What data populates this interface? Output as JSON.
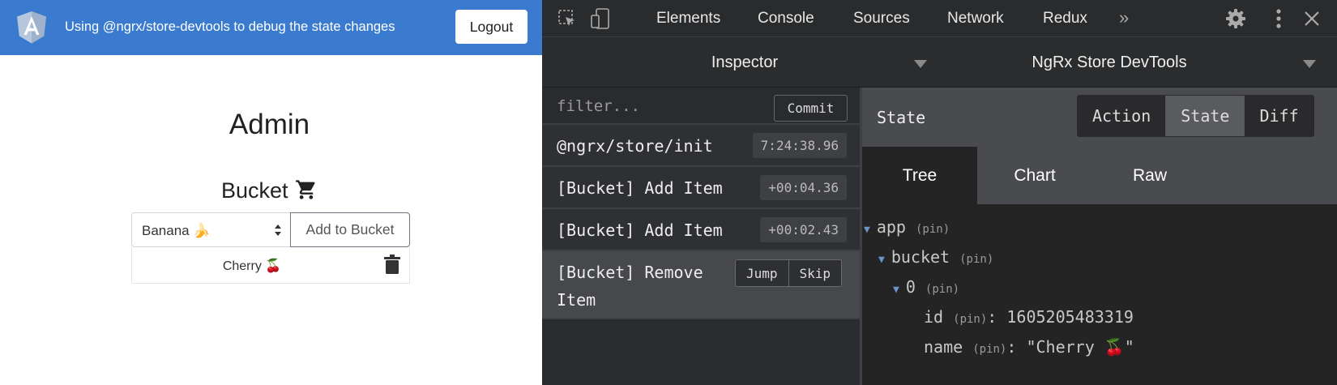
{
  "app": {
    "header_title": "Using @ngrx/store-devtools to debug the state changes",
    "logout_label": "Logout",
    "page_title": "Admin",
    "bucket_heading": "Bucket",
    "select_value": "Banana 🍌",
    "add_button_label": "Add to Bucket",
    "bucket_items": [
      "Cherry 🍒"
    ],
    "brand_color": "#3a7bd0"
  },
  "devtools": {
    "tabs": [
      "Elements",
      "Console",
      "Sources",
      "Network",
      "Redux"
    ],
    "more_tabs_glyph": "»",
    "panels": {
      "left": "Inspector",
      "right": "NgRx Store DevTools"
    },
    "filter_placeholder": "filter...",
    "commit_label": "Commit",
    "actions": [
      {
        "label": "@ngrx/store/init",
        "time": "7:24:38.96"
      },
      {
        "label": "[Bucket] Add Item",
        "time": "+00:04.36"
      },
      {
        "label": "[Bucket] Add Item",
        "time": "+00:02.43"
      },
      {
        "label": "[Bucket] Remove Item",
        "jump": "Jump",
        "skip": "Skip"
      }
    ],
    "state_title": "State",
    "modes": [
      "Action",
      "State",
      "Diff"
    ],
    "active_mode": "State",
    "subtabs": [
      "Tree",
      "Chart",
      "Raw"
    ],
    "active_subtab": "Tree",
    "tree": {
      "pin": "(pin)",
      "root": "app",
      "child": "bucket",
      "index": "0",
      "fields": [
        {
          "key": "id",
          "value": "1605205483319"
        },
        {
          "key": "name",
          "value": "\"Cherry 🍒\""
        }
      ]
    },
    "colors": {
      "background": "#242424",
      "toolbar": "#2a2b2d",
      "accent_arrow": "#6b94c9"
    }
  }
}
